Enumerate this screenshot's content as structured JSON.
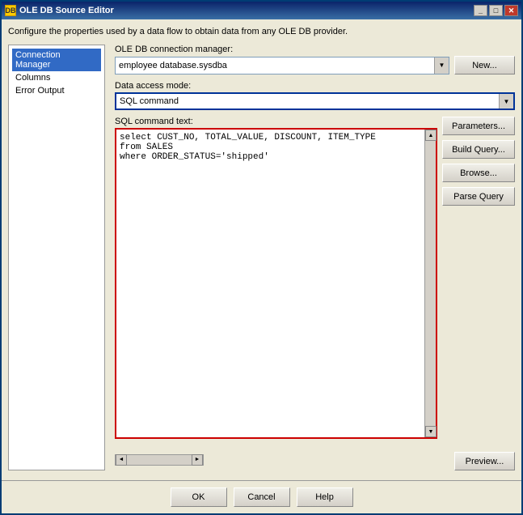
{
  "window": {
    "title": "OLE DB Source Editor",
    "icon": "DB"
  },
  "description": "Configure the properties used by a data flow to obtain data from any OLE DB provider.",
  "nav": {
    "items": [
      {
        "label": "Connection Manager",
        "active": true
      },
      {
        "label": "Columns",
        "active": false
      },
      {
        "label": "Error Output",
        "active": false
      }
    ]
  },
  "form": {
    "connection_label": "OLE DB connection manager:",
    "connection_value": "employee database.sysdba",
    "new_button": "New...",
    "data_access_label": "Data access mode:",
    "data_access_value": "SQL command",
    "sql_command_label": "SQL command text:",
    "sql_text": "select CUST_NO, TOTAL_VALUE, DISCOUNT, ITEM_TYPE\nfrom SALES\nwhere ORDER_STATUS='shipped'",
    "parameters_button": "Parameters...",
    "build_query_button": "Build Query...",
    "browse_button": "Browse...",
    "parse_query_button": "Parse Query",
    "preview_button": "Preview..."
  },
  "footer": {
    "ok_button": "OK",
    "cancel_button": "Cancel",
    "help_button": "Help"
  }
}
